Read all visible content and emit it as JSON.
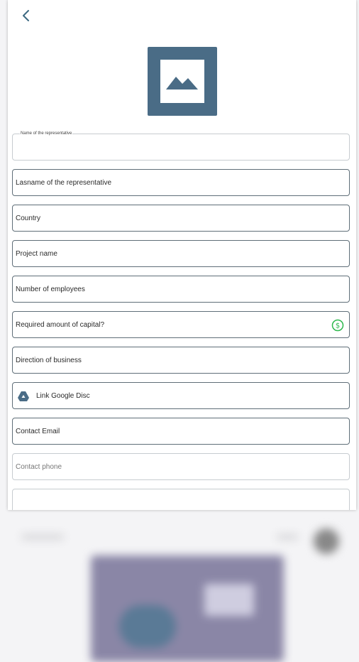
{
  "form": {
    "fields": [
      {
        "label": "Name of the representative"
      },
      {
        "label": "Lasname of the representative"
      },
      {
        "label": "Country"
      },
      {
        "label": "Project name"
      },
      {
        "label": "Number of employees"
      },
      {
        "label": "Required amount of capital?"
      },
      {
        "label": "Direction of business"
      },
      {
        "label": "Link Google Disc"
      },
      {
        "label": "Contact Email"
      },
      {
        "label": "Contact phone"
      }
    ]
  },
  "icons": {
    "back": "chevron-left-icon",
    "logo": "image-placeholder-icon",
    "capital": "dollar-circle-icon",
    "drive": "google-drive-icon"
  },
  "colors": {
    "accent": "#4a6c86",
    "dollar_icon": "#2db84d",
    "border": "#5f6e78"
  }
}
